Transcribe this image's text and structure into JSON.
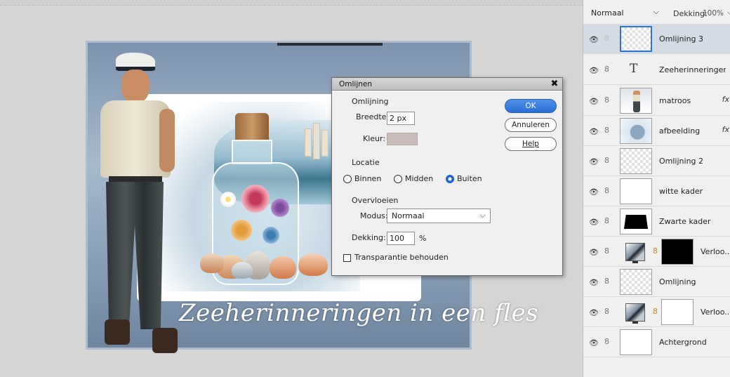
{
  "canvas": {
    "caption": "Zeeherinneringen in een fles"
  },
  "dialog": {
    "title": "Omlijnen",
    "section_outline": "Omlijning",
    "width_label": "Breedte:",
    "width_value": "2 px",
    "color_label": "Kleur:",
    "color_value": "#c9bcbb",
    "location_label": "Locatie",
    "location_options": [
      "Binnen",
      "Midden",
      "Buiten"
    ],
    "location_selected": "Buiten",
    "blending_label": "Overvloeien",
    "mode_label": "Modus:",
    "mode_value": "Normaal",
    "opacity_label": "Dekking:",
    "opacity_value": "100",
    "opacity_unit": "%",
    "preserve_transparency_label": "Transparantie behouden",
    "preserve_transparency_checked": false,
    "buttons": {
      "ok": "OK",
      "cancel": "Annuleren",
      "help": "Help"
    },
    "close_glyph": "✖"
  },
  "layers_panel": {
    "blend_mode": "Normaal",
    "opacity_label": "Dekking:",
    "opacity_value": "100%",
    "layers": [
      {
        "name": "Omlijning 3",
        "thumb": "transparent",
        "selected": true,
        "fx": false
      },
      {
        "name": "Zeeherinneringen i...",
        "thumb": "text",
        "selected": false,
        "fx": false
      },
      {
        "name": "matroos",
        "thumb": "sailor",
        "selected": false,
        "fx": true
      },
      {
        "name": "afbeelding",
        "thumb": "image",
        "selected": false,
        "fx": true
      },
      {
        "name": "Omlijning 2",
        "thumb": "transparent",
        "selected": false,
        "fx": false
      },
      {
        "name": "witte kader",
        "thumb": "white",
        "selected": false,
        "fx": false
      },
      {
        "name": "Zwarte kader",
        "thumb": "black-frame",
        "selected": false,
        "fx": false
      },
      {
        "name": "Verloo...",
        "thumb": "gradient-adjust",
        "mask": "black",
        "selected": false,
        "fx": false
      },
      {
        "name": "Omlijning",
        "thumb": "transparent",
        "selected": false,
        "fx": false
      },
      {
        "name": "Verloo...",
        "thumb": "gradient-adjust",
        "mask": "white",
        "selected": false,
        "fx": false
      },
      {
        "name": "Achtergrond",
        "thumb": "white",
        "selected": false,
        "fx": false
      }
    ],
    "fx_glyph": "fx",
    "text_glyph": "T"
  },
  "colors": {
    "ok_button": "#2a6ed6",
    "selected_layer_bg": "#d4dbe4",
    "selected_thumb_border": "#2d74d6",
    "stroke_color_swatch": "#c9bcbb"
  }
}
